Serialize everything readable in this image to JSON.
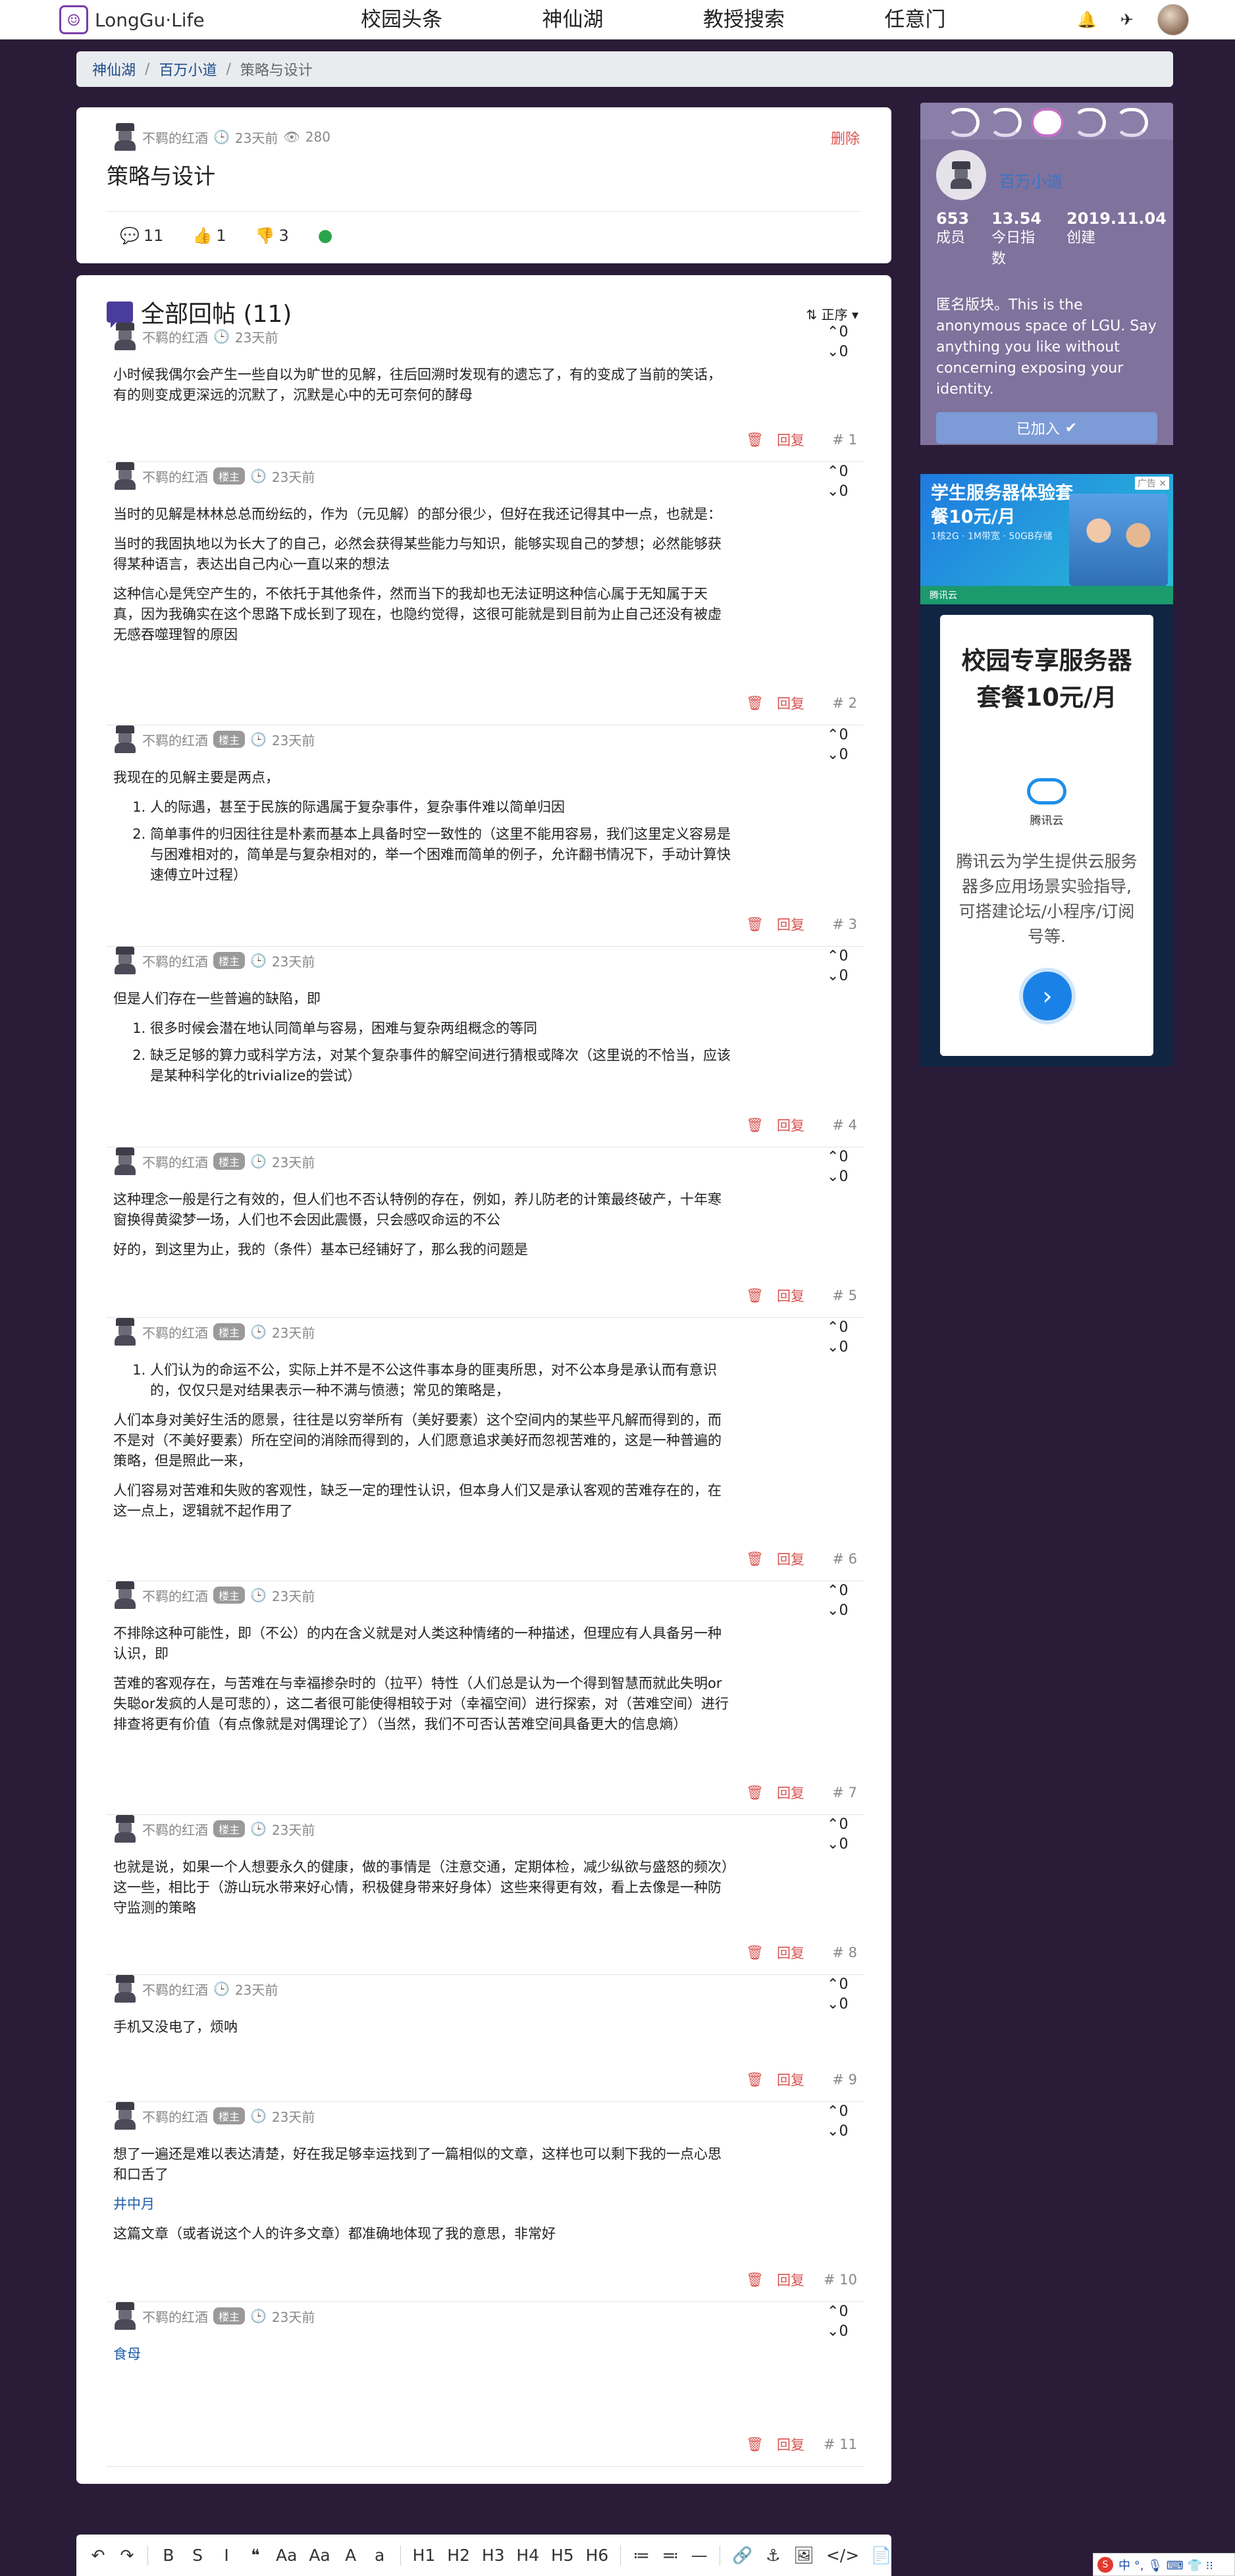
{
  "nav": {
    "brand": "LongGu·Life",
    "links": [
      "校园头条",
      "神仙湖",
      "教授搜索",
      "任意门"
    ],
    "icons": [
      "bell-icon",
      "send-icon"
    ]
  },
  "breadcrumb": [
    "神仙湖",
    "百万小道",
    "策略与设计"
  ],
  "post": {
    "author": "不羁的红酒",
    "time": "23天前",
    "views": "280",
    "delete_label": "删除",
    "title": "策略与设计",
    "stats": {
      "comments": "11",
      "likes": "1",
      "dislikes": "3"
    }
  },
  "replies_header": {
    "title": "全部回帖 (11)",
    "sort_label": "正序"
  },
  "replies": [
    {
      "author": "不羁的红酒",
      "badge": "",
      "time": "23天前",
      "up": "0",
      "down": "0",
      "floor": "# 1",
      "reply_label": "回复",
      "paragraphs": [
        "小时候我偶尔会产生一些自以为旷世的见解，往后回溯时发现有的遗忘了，有的变成了当前的笑话，有的则变成更深远的沉默了，沉默是心中的无可奈何的酵母"
      ]
    },
    {
      "author": "不羁的红酒",
      "badge": "楼主",
      "time": "23天前",
      "up": "0",
      "down": "0",
      "floor": "# 2",
      "reply_label": "回复",
      "paragraphs": [
        "当时的见解是林林总总而纷纭的，作为（元见解）的部分很少，但好在我还记得其中一点，也就是：",
        "当时的我固执地以为长大了的自己，必然会获得某些能力与知识，能够实现自己的梦想；必然能够获得某种语言，表达出自己内心一直以来的想法",
        "这种信心是凭空产生的，不依托于其他条件，然而当下的我却也无法证明这种信心属于无知属于天真，因为我确实在这个思路下成长到了现在，也隐约觉得，这很可能就是到目前为止自己还没有被虚无感吞噬理智的原因"
      ]
    },
    {
      "author": "不羁的红酒",
      "badge": "楼主",
      "time": "23天前",
      "up": "0",
      "down": "0",
      "floor": "# 3",
      "reply_label": "回复",
      "paragraphs": [
        "我现在的见解主要是两点，"
      ],
      "list": [
        "人的际遇，甚至于民族的际遇属于复杂事件，复杂事件难以简单归因",
        "简单事件的归因往往是朴素而基本上具备时空一致性的（这里不能用容易，我们这里定义容易是与困难相对的，简单是与复杂相对的，举一个困难而简单的例子，允许翻书情况下，手动计算快速傅立叶过程）"
      ]
    },
    {
      "author": "不羁的红酒",
      "badge": "楼主",
      "time": "23天前",
      "up": "0",
      "down": "0",
      "floor": "# 4",
      "reply_label": "回复",
      "paragraphs": [
        "但是人们存在一些普遍的缺陷，即"
      ],
      "list": [
        "很多时候会潜在地认同简单与容易，困难与复杂两组概念的等同",
        "缺乏足够的算力或科学方法，对某个复杂事件的解空间进行猜根或降次（这里说的不恰当，应该是某种科学化的trivialize的尝试）"
      ]
    },
    {
      "author": "不羁的红酒",
      "badge": "楼主",
      "time": "23天前",
      "up": "0",
      "down": "0",
      "floor": "# 5",
      "reply_label": "回复",
      "paragraphs": [
        "这种理念一般是行之有效的，但人们也不否认特例的存在，例如，养儿防老的计策最终破产，十年寒窗换得黄粱梦一场，人们也不会因此震慑，只会感叹命运的不公",
        "好的，到这里为止，我的（条件）基本已经铺好了，那么我的问题是"
      ]
    },
    {
      "author": "不羁的红酒",
      "badge": "楼主",
      "time": "23天前",
      "up": "0",
      "down": "0",
      "floor": "# 6",
      "reply_label": "回复",
      "list_first": [
        "人们认为的命运不公，实际上并不是不公这件事本身的匪夷所思，对不公本身是承认而有意识的，仅仅只是对结果表示一种不满与愤懑；常见的策略是，"
      ],
      "paragraphs": [
        "人们本身对美好生活的愿景，往往是以穷举所有（美好要素）这个空间内的某些平凡解而得到的，而不是对（不美好要素）所在空间的消除而得到的，人们愿意追求美好而忽视苦难的，这是一种普遍的策略，但是照此一来，",
        "人们容易对苦难和失败的客观性，缺乏一定的理性认识，但本身人们又是承认客观的苦难存在的，在这一点上，逻辑就不起作用了"
      ]
    },
    {
      "author": "不羁的红酒",
      "badge": "楼主",
      "time": "23天前",
      "up": "0",
      "down": "0",
      "floor": "# 7",
      "reply_label": "回复",
      "paragraphs": [
        "不排除这种可能性，即（不公）的内在含义就是对人类这种情绪的一种描述，但理应有人具备另一种认识，即",
        "苦难的客观存在，与苦难在与幸福掺杂时的（拉平）特性（人们总是认为一个得到智慧而就此失明or失聪or发疯的人是可悲的），这二者很可能使得相较于对（幸福空间）进行探索，对（苦难空间）进行排查将更有价值（有点像就是对偶理论了）（当然，我们不可否认苦难空间具备更大的信息熵）"
      ]
    },
    {
      "author": "不羁的红酒",
      "badge": "楼主",
      "time": "23天前",
      "up": "0",
      "down": "0",
      "floor": "# 8",
      "reply_label": "回复",
      "paragraphs": [
        "也就是说，如果一个人想要永久的健康，做的事情是（注意交通，定期体检，减少纵欲与盛怒的频次）这一些，相比于（游山玩水带来好心情，积极健身带来好身体）这些来得更有效，看上去像是一种防守监测的策略"
      ]
    },
    {
      "author": "不羁的红酒",
      "badge": "",
      "time": "23天前",
      "up": "0",
      "down": "0",
      "floor": "# 9",
      "reply_label": "回复",
      "paragraphs": [
        "手机又没电了，烦呐"
      ]
    },
    {
      "author": "不羁的红酒",
      "badge": "楼主",
      "time": "23天前",
      "up": "0",
      "down": "0",
      "floor": "# 10",
      "reply_label": "回复",
      "paragraphs": [
        "想了一遍还是难以表达清楚，好在我足够幸运找到了一篇相似的文章，这样也可以剩下我的一点心思和口舌了"
      ],
      "link": "井中月",
      "after_link": [
        "这篇文章（或者说这个人的许多文章）都准确地体现了我的意思，非常好"
      ]
    },
    {
      "author": "不羁的红酒",
      "badge": "楼主",
      "time": "23天前",
      "up": "0",
      "down": "0",
      "floor": "# 11",
      "reply_label": "回复",
      "link_only": "食母"
    }
  ],
  "community": {
    "name": "百万小道",
    "members": "653",
    "members_label": "成员",
    "index": "13.54",
    "index_label": "今日指数",
    "created": "2019.11.04",
    "created_label": "创建",
    "description": "匿名版块。This is the anonymous space of LGU. Say anything you like without concerning exposing your identity.",
    "joined_label": "已加入"
  },
  "ad": {
    "badge": "广告",
    "top_title": "学生服务器体验套餐10元/月",
    "top_sub": "1核2G · 1M带宽 · 50GB存储",
    "strip": "腾讯云",
    "big_text": "校园专享服务器套餐10元/月",
    "brand": "腾讯云",
    "desc": "腾讯云为学生提供云服务器多应用场景实验指导,可搭建论坛/小程序/订阅号等."
  },
  "editor": {
    "buttons": [
      "↶",
      "↷",
      "B",
      "S",
      "I",
      "❝",
      "Aa",
      "Aa",
      "A",
      "a",
      "H1",
      "H2",
      "H3",
      "H4",
      "H5",
      "H6",
      "≔",
      "≕",
      "—",
      "🔗",
      "⚓",
      "🖼",
      "</>",
      "📄"
    ]
  },
  "ime": {
    "text": "中 °, 🎙 ⌨ 👕 ⁝⁝"
  }
}
